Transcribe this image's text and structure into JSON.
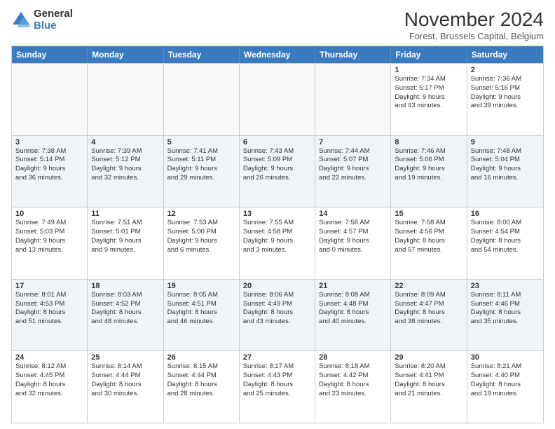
{
  "logo": {
    "general": "General",
    "blue": "Blue"
  },
  "title": "November 2024",
  "subtitle": "Forest, Brussels Capital, Belgium",
  "days": [
    "Sunday",
    "Monday",
    "Tuesday",
    "Wednesday",
    "Thursday",
    "Friday",
    "Saturday"
  ],
  "rows": [
    [
      {
        "day": "",
        "lines": []
      },
      {
        "day": "",
        "lines": []
      },
      {
        "day": "",
        "lines": []
      },
      {
        "day": "",
        "lines": []
      },
      {
        "day": "",
        "lines": []
      },
      {
        "day": "1",
        "lines": [
          "Sunrise: 7:34 AM",
          "Sunset: 5:17 PM",
          "Daylight: 9 hours",
          "and 43 minutes."
        ]
      },
      {
        "day": "2",
        "lines": [
          "Sunrise: 7:36 AM",
          "Sunset: 5:16 PM",
          "Daylight: 9 hours",
          "and 39 minutes."
        ]
      }
    ],
    [
      {
        "day": "3",
        "lines": [
          "Sunrise: 7:38 AM",
          "Sunset: 5:14 PM",
          "Daylight: 9 hours",
          "and 36 minutes."
        ]
      },
      {
        "day": "4",
        "lines": [
          "Sunrise: 7:39 AM",
          "Sunset: 5:12 PM",
          "Daylight: 9 hours",
          "and 32 minutes."
        ]
      },
      {
        "day": "5",
        "lines": [
          "Sunrise: 7:41 AM",
          "Sunset: 5:11 PM",
          "Daylight: 9 hours",
          "and 29 minutes."
        ]
      },
      {
        "day": "6",
        "lines": [
          "Sunrise: 7:43 AM",
          "Sunset: 5:09 PM",
          "Daylight: 9 hours",
          "and 26 minutes."
        ]
      },
      {
        "day": "7",
        "lines": [
          "Sunrise: 7:44 AM",
          "Sunset: 5:07 PM",
          "Daylight: 9 hours",
          "and 22 minutes."
        ]
      },
      {
        "day": "8",
        "lines": [
          "Sunrise: 7:46 AM",
          "Sunset: 5:06 PM",
          "Daylight: 9 hours",
          "and 19 minutes."
        ]
      },
      {
        "day": "9",
        "lines": [
          "Sunrise: 7:48 AM",
          "Sunset: 5:04 PM",
          "Daylight: 9 hours",
          "and 16 minutes."
        ]
      }
    ],
    [
      {
        "day": "10",
        "lines": [
          "Sunrise: 7:49 AM",
          "Sunset: 5:03 PM",
          "Daylight: 9 hours",
          "and 13 minutes."
        ]
      },
      {
        "day": "11",
        "lines": [
          "Sunrise: 7:51 AM",
          "Sunset: 5:01 PM",
          "Daylight: 9 hours",
          "and 9 minutes."
        ]
      },
      {
        "day": "12",
        "lines": [
          "Sunrise: 7:53 AM",
          "Sunset: 5:00 PM",
          "Daylight: 9 hours",
          "and 6 minutes."
        ]
      },
      {
        "day": "13",
        "lines": [
          "Sunrise: 7:55 AM",
          "Sunset: 4:58 PM",
          "Daylight: 9 hours",
          "and 3 minutes."
        ]
      },
      {
        "day": "14",
        "lines": [
          "Sunrise: 7:56 AM",
          "Sunset: 4:57 PM",
          "Daylight: 9 hours",
          "and 0 minutes."
        ]
      },
      {
        "day": "15",
        "lines": [
          "Sunrise: 7:58 AM",
          "Sunset: 4:56 PM",
          "Daylight: 8 hours",
          "and 57 minutes."
        ]
      },
      {
        "day": "16",
        "lines": [
          "Sunrise: 8:00 AM",
          "Sunset: 4:54 PM",
          "Daylight: 8 hours",
          "and 54 minutes."
        ]
      }
    ],
    [
      {
        "day": "17",
        "lines": [
          "Sunrise: 8:01 AM",
          "Sunset: 4:53 PM",
          "Daylight: 8 hours",
          "and 51 minutes."
        ]
      },
      {
        "day": "18",
        "lines": [
          "Sunrise: 8:03 AM",
          "Sunset: 4:52 PM",
          "Daylight: 8 hours",
          "and 48 minutes."
        ]
      },
      {
        "day": "19",
        "lines": [
          "Sunrise: 8:05 AM",
          "Sunset: 4:51 PM",
          "Daylight: 8 hours",
          "and 46 minutes."
        ]
      },
      {
        "day": "20",
        "lines": [
          "Sunrise: 8:06 AM",
          "Sunset: 4:49 PM",
          "Daylight: 8 hours",
          "and 43 minutes."
        ]
      },
      {
        "day": "21",
        "lines": [
          "Sunrise: 8:08 AM",
          "Sunset: 4:48 PM",
          "Daylight: 8 hours",
          "and 40 minutes."
        ]
      },
      {
        "day": "22",
        "lines": [
          "Sunrise: 8:09 AM",
          "Sunset: 4:47 PM",
          "Daylight: 8 hours",
          "and 38 minutes."
        ]
      },
      {
        "day": "23",
        "lines": [
          "Sunrise: 8:11 AM",
          "Sunset: 4:46 PM",
          "Daylight: 8 hours",
          "and 35 minutes."
        ]
      }
    ],
    [
      {
        "day": "24",
        "lines": [
          "Sunrise: 8:12 AM",
          "Sunset: 4:45 PM",
          "Daylight: 8 hours",
          "and 32 minutes."
        ]
      },
      {
        "day": "25",
        "lines": [
          "Sunrise: 8:14 AM",
          "Sunset: 4:44 PM",
          "Daylight: 8 hours",
          "and 30 minutes."
        ]
      },
      {
        "day": "26",
        "lines": [
          "Sunrise: 8:15 AM",
          "Sunset: 4:44 PM",
          "Daylight: 8 hours",
          "and 28 minutes."
        ]
      },
      {
        "day": "27",
        "lines": [
          "Sunrise: 8:17 AM",
          "Sunset: 4:43 PM",
          "Daylight: 8 hours",
          "and 25 minutes."
        ]
      },
      {
        "day": "28",
        "lines": [
          "Sunrise: 8:18 AM",
          "Sunset: 4:42 PM",
          "Daylight: 8 hours",
          "and 23 minutes."
        ]
      },
      {
        "day": "29",
        "lines": [
          "Sunrise: 8:20 AM",
          "Sunset: 4:41 PM",
          "Daylight: 8 hours",
          "and 21 minutes."
        ]
      },
      {
        "day": "30",
        "lines": [
          "Sunrise: 8:21 AM",
          "Sunset: 4:40 PM",
          "Daylight: 8 hours",
          "and 19 minutes."
        ]
      }
    ]
  ]
}
